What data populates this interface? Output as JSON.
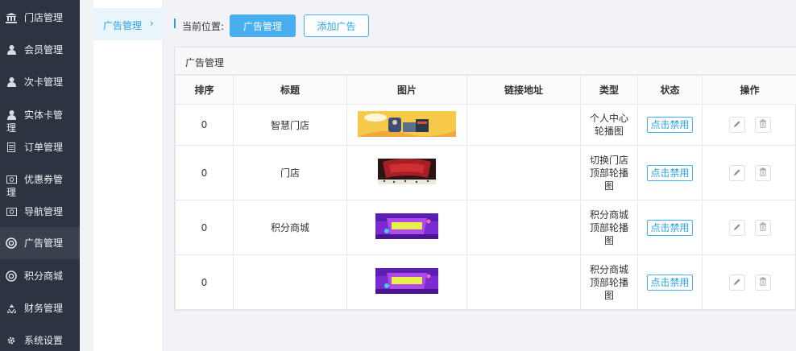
{
  "sidebar": {
    "items": [
      {
        "label": "门店管理",
        "icon": "bank-icon"
      },
      {
        "label": "会员管理",
        "icon": "user-icon"
      },
      {
        "label": "次卡管理",
        "icon": "user-icon"
      },
      {
        "label": "实体卡管理",
        "icon": "user-icon"
      },
      {
        "label": "订单管理",
        "icon": "document-icon"
      },
      {
        "label": "优惠券管理",
        "icon": "ticket-icon"
      },
      {
        "label": "导航管理",
        "icon": "ticket-icon"
      },
      {
        "label": "广告管理",
        "icon": "lifebuoy-icon"
      },
      {
        "label": "积分商城",
        "icon": "lifebuoy-icon"
      },
      {
        "label": "财务管理",
        "icon": "recycle-icon"
      },
      {
        "label": "系统设置",
        "icon": "gear-icon"
      }
    ],
    "active": "广告管理"
  },
  "submenu": {
    "active_label": "广告管理",
    "chevron": "›"
  },
  "breadcrumb": {
    "label": "当前位置:",
    "current_button": "广告管理",
    "add_button": "添加广告"
  },
  "panel": {
    "title": "广告管理"
  },
  "table": {
    "headers": [
      "排序",
      "标题",
      "图片",
      "链接地址",
      "类型",
      "状态",
      "操作"
    ],
    "rows": [
      {
        "order": "0",
        "title": "智慧门店",
        "link": "",
        "type": "个人中心轮播图",
        "status": "点击禁用"
      },
      {
        "order": "0",
        "title": "门店",
        "link": "",
        "type": "切换门店顶部轮播图",
        "status": "点击禁用"
      },
      {
        "order": "0",
        "title": "积分商城",
        "link": "",
        "type": "积分商城顶部轮播图",
        "status": "点击禁用"
      },
      {
        "order": "0",
        "title": "",
        "link": "",
        "type": "积分商城顶部轮播图",
        "status": "点击禁用"
      }
    ]
  },
  "colors": {
    "sidebar_bg": "#2b3440",
    "accent": "#2aa3e6",
    "primary_button": "#49aef0"
  }
}
